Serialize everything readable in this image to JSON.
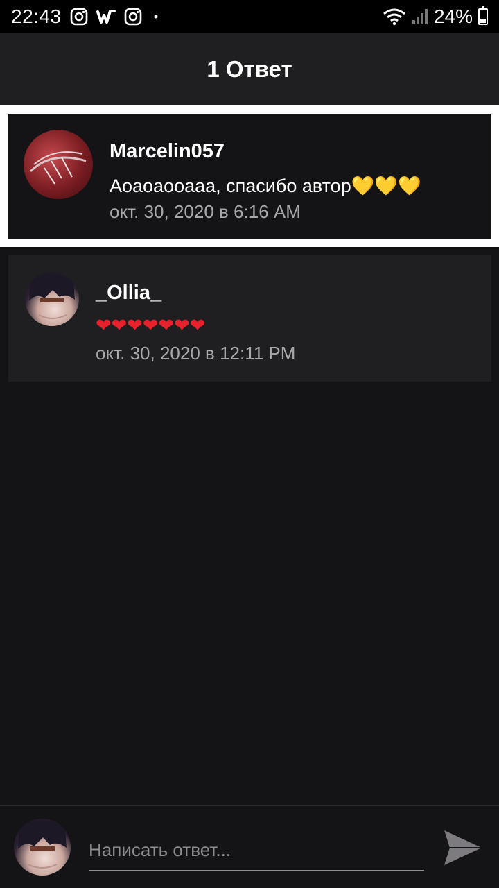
{
  "status_bar": {
    "time": "22:43",
    "battery": "24%",
    "icons": [
      "instagram-icon",
      "wattpad-icon",
      "instagram-icon",
      "dot-icon",
      "wifi-icon",
      "signal-icon",
      "battery-icon"
    ]
  },
  "header": {
    "title": "1 Ответ"
  },
  "parent_comment": {
    "username": "Marcelin057",
    "text": "Аоаоаооааа, спасибо автор",
    "emoji": "💛💛💛",
    "timestamp": "окт. 30, 2020 в 6:16 AM"
  },
  "reply": {
    "username": "_Ollia_",
    "emoji": "❤❤❤❤❤❤❤",
    "timestamp": "окт. 30, 2020 в 12:11 PM"
  },
  "composer": {
    "placeholder": "Написать ответ..."
  },
  "colors": {
    "background": "#141315",
    "card": "#1f1e20",
    "muted_text": "#a9a7ac",
    "highlight_border": "#ffffff"
  }
}
